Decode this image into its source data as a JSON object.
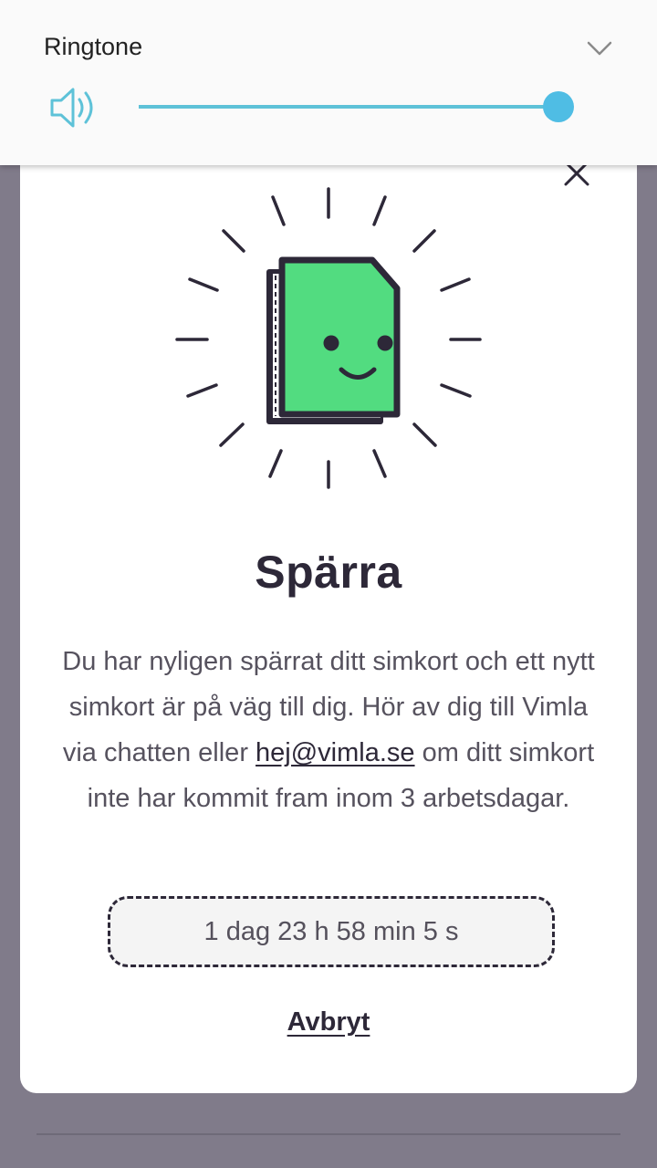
{
  "volume_panel": {
    "label": "Ringtone",
    "level": 0.97,
    "accent_color": "#5ec2d8",
    "icons": [
      "speaker-icon",
      "chevron-down-icon"
    ]
  },
  "modal": {
    "title": "Spärra",
    "message_part1": "Du har nyligen spärrat ditt simkort och ett nytt simkort är på väg till dig. Hör av dig till Vimla via chatten eller",
    "email_link": "hej@vimla.se",
    "message_part2": "om ditt simkort inte har kommit fram inom 3 arbetsdagar.",
    "countdown": "1 dag 23 h 58 min 5 s",
    "cancel_label": "Avbryt",
    "illustration_icon": "happy-simcard-icon",
    "illustration_color": "#52dc80",
    "text_color": "#2d2838"
  }
}
